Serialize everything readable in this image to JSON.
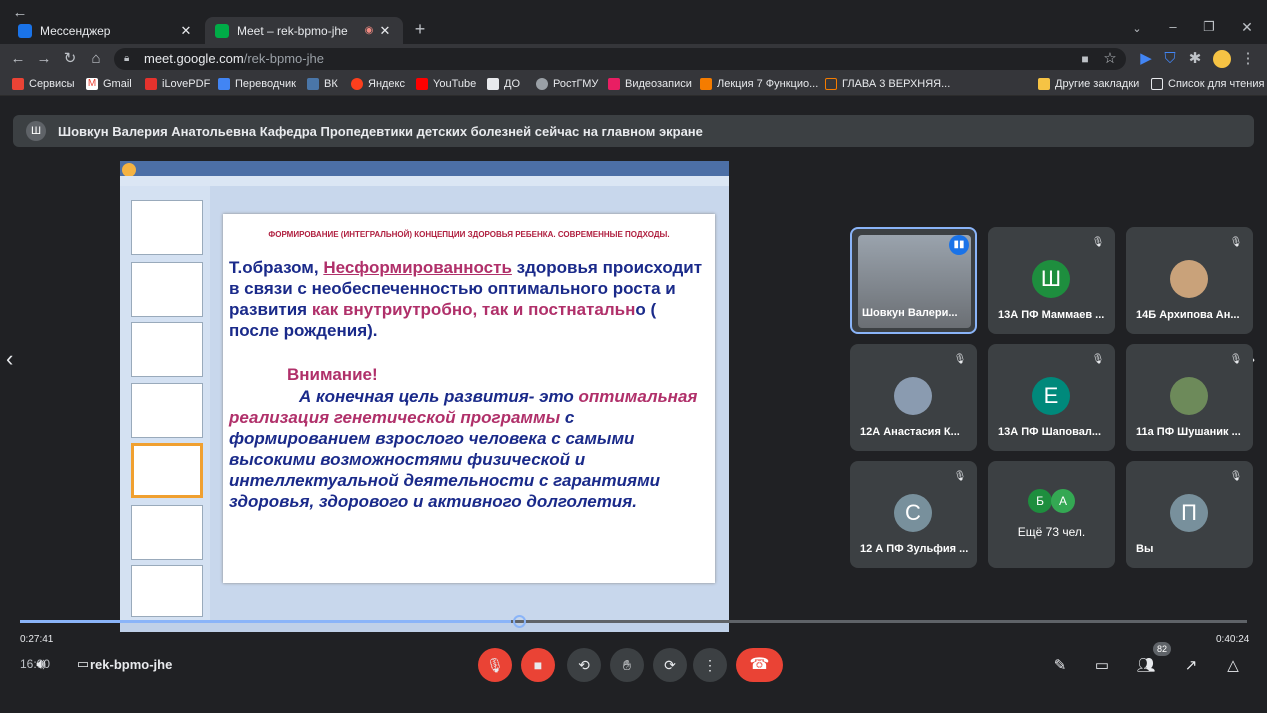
{
  "browser": {
    "tabs": [
      {
        "title": "Мессенджер",
        "active": false
      },
      {
        "title": "Meet – rek-bpmo-jhe",
        "active": true
      }
    ],
    "url_host": "meet.google.com",
    "url_path": "/rek-bpmo-jhe",
    "bookmarks": [
      "Сервисы",
      "Gmail",
      "iLovePDF",
      "Переводчик",
      "ВК",
      "Яндекс",
      "YouTube",
      "ДО",
      "РостГМУ",
      "Видеозаписи",
      "Лекция 7 Функцио...",
      "ГЛАВА 3 ВЕРХНЯЯ...",
      "Другие закладки",
      "Список для чтения"
    ]
  },
  "meet": {
    "banner_initial": "Ш",
    "banner_text": "Шовкун Валерия Анатольевна Кафедра Пропедевтики детских болезней сейчас на главном экране",
    "meeting_code": "rek-bpmo-jhe",
    "time_elapsed": "0:27:41",
    "time_total": "0:40:24",
    "clock_partial": "16:00",
    "people_count": "82",
    "progress_fraction": 0.4
  },
  "slide": {
    "header": "ФОРМИРОВАНИЕ  (ИНТЕГРАЛЬНОЙ)  КОНЦЕПЦИИ ЗДОРОВЬЯ РЕБЕНКА.  СОВРЕМЕННЫЕ ПОДХОДЫ.",
    "p1_a": "Т.образом, ",
    "p1_b": "Несформированность",
    "p1_c": " здоровья происходит в связи с необеспеченностью оптимального роста и развития ",
    "p1_d": " как внутриутробно, так и постнатальн",
    "p1_e": "о ( после рождения).",
    "attention": "Внимание!",
    "p2_a": "А  конечная цель развития- это ",
    "p2_b": "оптимальная реализация генетической программы",
    "p2_c": " с формированием  взрослого человека  с самыми высокими  возможностями физической и интеллектуальной деятельности с гарантиями здоровья,  здорового и активного долголетия."
  },
  "participants": [
    {
      "name": "Шовкун Валери...",
      "initial": "",
      "color": "#777777",
      "muted": false
    },
    {
      "name": "13А ПФ Маммаев ...",
      "initial": "Ш",
      "color": "#1e8e3e",
      "muted": true
    },
    {
      "name": "14Б Архипова Ан...",
      "initial": "",
      "color": "#c9a27a",
      "muted": true
    },
    {
      "name": "12А Анастасия К...",
      "initial": "",
      "color": "#8a9bb0",
      "muted": true
    },
    {
      "name": "13А ПФ Шаповал...",
      "initial": "Е",
      "color": "#00897b",
      "muted": true
    },
    {
      "name": "11а ПФ Шушаник ...",
      "initial": "",
      "color": "#6d8a5a",
      "muted": true
    },
    {
      "name": "12 А ПФ Зульфия ...",
      "initial": "С",
      "color": "#78909c",
      "muted": true
    },
    {
      "name": "Ещё 73 чел.",
      "initial": "",
      "color": "",
      "muted": false
    },
    {
      "name": "Вы",
      "initial": "П",
      "color": "#78909c",
      "muted": true
    }
  ],
  "more_initials": [
    "Б",
    "А"
  ]
}
